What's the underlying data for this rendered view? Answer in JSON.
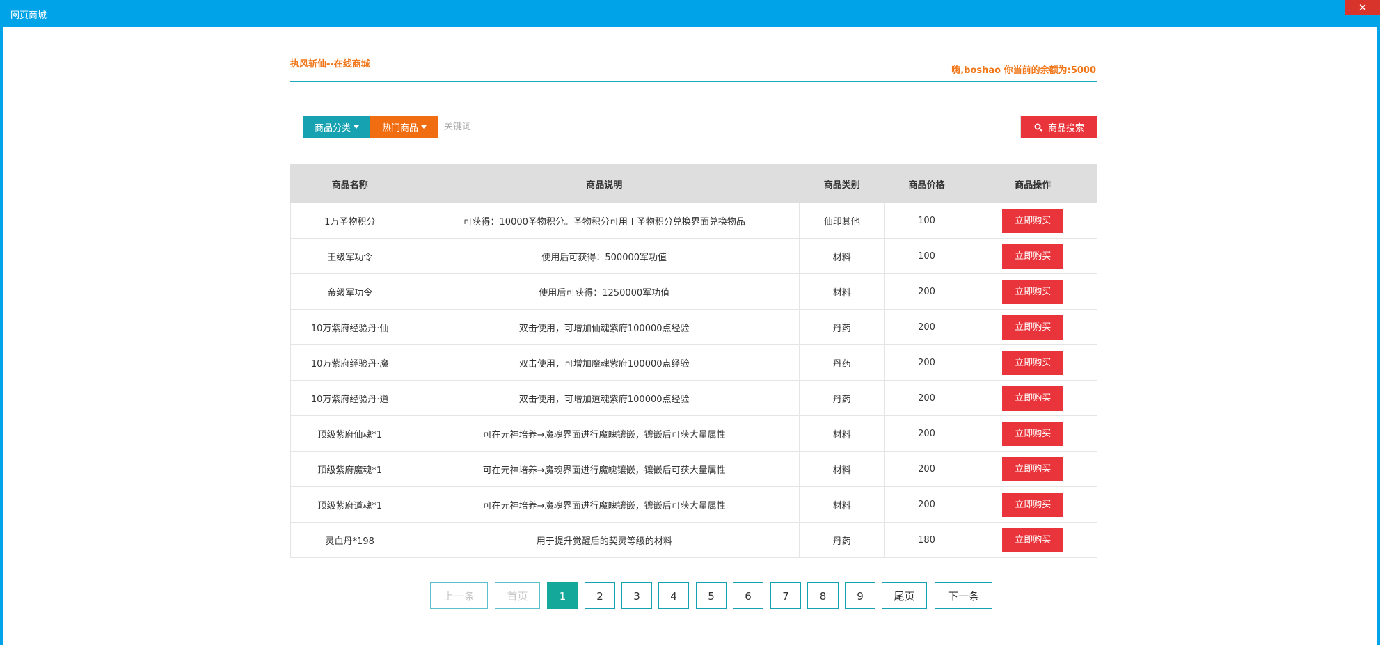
{
  "window": {
    "title": "网页商城",
    "close_glyph": "✕"
  },
  "header": {
    "shop_title": "执风斩仙--在线商城",
    "balance_text": "嗨,boshao 你当前的余额为:5000"
  },
  "search": {
    "category_label": "商品分类",
    "hot_label": "热门商品",
    "placeholder": "关键词",
    "value": "",
    "search_label": "商品搜索"
  },
  "table": {
    "columns": [
      "商品名称",
      "商品说明",
      "商品类别",
      "商品价格",
      "商品操作"
    ],
    "rows": [
      {
        "name": "1万圣物积分",
        "desc": "可获得：10000圣物积分。圣物积分可用于圣物积分兑换界面兑换物品",
        "category": "仙印其他",
        "price": "100",
        "action": "立即购买"
      },
      {
        "name": "王级军功令",
        "desc": "使用后可获得：500000军功值",
        "category": "材料",
        "price": "100",
        "action": "立即购买"
      },
      {
        "name": "帝级军功令",
        "desc": "使用后可获得：1250000军功值",
        "category": "材料",
        "price": "200",
        "action": "立即购买"
      },
      {
        "name": "10万紫府经验丹·仙",
        "desc": "双击使用，可增加仙魂紫府100000点经验",
        "category": "丹药",
        "price": "200",
        "action": "立即购买"
      },
      {
        "name": "10万紫府经验丹·魔",
        "desc": "双击使用，可增加魔魂紫府100000点经验",
        "category": "丹药",
        "price": "200",
        "action": "立即购买"
      },
      {
        "name": "10万紫府经验丹·道",
        "desc": "双击使用，可增加道魂紫府100000点经验",
        "category": "丹药",
        "price": "200",
        "action": "立即购买"
      },
      {
        "name": "顶级紫府仙魂*1",
        "desc": "可在元神培养→魔魂界面进行魔魄镶嵌，镶嵌后可获大量属性",
        "category": "材料",
        "price": "200",
        "action": "立即购买"
      },
      {
        "name": "顶级紫府魔魂*1",
        "desc": "可在元神培养→魔魂界面进行魔魄镶嵌，镶嵌后可获大量属性",
        "category": "材料",
        "price": "200",
        "action": "立即购买"
      },
      {
        "name": "顶级紫府道魂*1",
        "desc": "可在元神培养→魔魂界面进行魔魄镶嵌，镶嵌后可获大量属性",
        "category": "材料",
        "price": "200",
        "action": "立即购买"
      },
      {
        "name": "灵血丹*198",
        "desc": "用于提升觉醒后的契灵等级的材料",
        "category": "丹药",
        "price": "180",
        "action": "立即购买"
      }
    ]
  },
  "pagination": {
    "prev": "上一条",
    "first": "首页",
    "pages": [
      "1",
      "2",
      "3",
      "4",
      "5",
      "6",
      "7",
      "8",
      "9"
    ],
    "current": "1",
    "last": "尾页",
    "next": "下一条"
  },
  "colors": {
    "titlebar": "#00a3e8",
    "accent_orange": "#f07618",
    "teal": "#17a2b2",
    "red": "#e8343a",
    "active_page": "#14a89a"
  },
  "icons": {
    "search": "search-icon",
    "close": "close-icon"
  }
}
